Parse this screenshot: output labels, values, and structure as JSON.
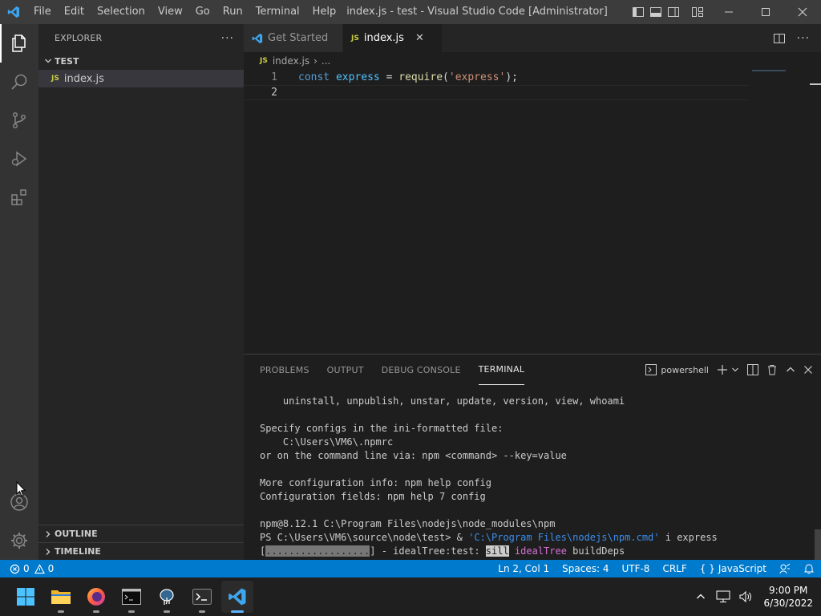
{
  "titlebar": {
    "menu": [
      "File",
      "Edit",
      "Selection",
      "View",
      "Go",
      "Run",
      "Terminal",
      "Help"
    ],
    "title": "index.js - test - Visual Studio Code [Administrator]"
  },
  "sidebar": {
    "header": "EXPLORER",
    "more": "···",
    "folder": "TEST",
    "file": "index.js",
    "file_badge": "JS",
    "outline": "OUTLINE",
    "timeline": "TIMELINE"
  },
  "tabs": [
    {
      "label": "Get Started",
      "icon": "vscode-icon"
    },
    {
      "label": "index.js",
      "badge": "JS",
      "close": "✕"
    }
  ],
  "breadcrumb": {
    "badge": "JS",
    "file": "index.js",
    "sep": "›",
    "more": "..."
  },
  "editor": {
    "lines": [
      {
        "number": "1",
        "tokens": [
          {
            "text": "const ",
            "cls": "kw"
          },
          {
            "text": "express",
            "cls": "var"
          },
          {
            "text": " = ",
            "cls": "punc"
          },
          {
            "text": "require",
            "cls": "fn"
          },
          {
            "text": "(",
            "cls": "punc"
          },
          {
            "text": "'express'",
            "cls": "str"
          },
          {
            "text": ");",
            "cls": "punc"
          }
        ]
      },
      {
        "number": "2",
        "tokens": []
      }
    ]
  },
  "panel": {
    "tabs": [
      "PROBLEMS",
      "OUTPUT",
      "DEBUG CONSOLE",
      "TERMINAL"
    ],
    "active_tab": "TERMINAL",
    "shell": "powershell",
    "terminal_lines": [
      [
        {
          "text": "    uninstall, unpublish, unstar, update, version, view, whoami"
        }
      ],
      [
        {
          "text": ""
        }
      ],
      [
        {
          "text": "Specify configs in the ini-formatted file:"
        }
      ],
      [
        {
          "text": "    C:\\Users\\VM6\\.npmrc"
        }
      ],
      [
        {
          "text": "or on the command line via: npm <command> --key=value"
        }
      ],
      [
        {
          "text": ""
        }
      ],
      [
        {
          "text": "More configuration info: npm help config"
        }
      ],
      [
        {
          "text": "Configuration fields: npm help 7 config"
        }
      ],
      [
        {
          "text": ""
        }
      ],
      [
        {
          "text": "npm@8.12.1 C:\\Program Files\\nodejs\\node_modules\\npm"
        }
      ],
      [
        {
          "text": "PS C:\\Users\\VM6\\source\\node\\test> & "
        },
        {
          "text": "'C:\\Program Files\\nodejs\\npm.cmd'",
          "cls": "tstr"
        },
        {
          "text": " i express"
        }
      ],
      [
        {
          "text": "["
        },
        {
          "text": "..................",
          "cls": "tprog"
        },
        {
          "text": "] - idealTree:test: "
        },
        {
          "text": "sill",
          "cls": "tsill"
        },
        {
          "text": " "
        },
        {
          "text": "idealTree",
          "cls": "tmag"
        },
        {
          "text": " buildDeps"
        }
      ]
    ]
  },
  "statusbar": {
    "errors": "0",
    "warnings": "0",
    "position": "Ln 2, Col 1",
    "spaces": "Spaces: 4",
    "encoding": "UTF-8",
    "eol": "CRLF",
    "language_braces": "{ }",
    "language": "JavaScript"
  },
  "taskbar": {
    "apps": [
      "windows-start",
      "file-explorer",
      "firefox",
      "command-prompt",
      "pgadmin",
      "terminal",
      "vscode"
    ],
    "time": "9:00 PM",
    "date": "6/30/2022"
  },
  "colors": {
    "accent": "#007acc",
    "activity_bar": "#333333",
    "sidebar": "#252526",
    "editor": "#1e1e1e",
    "titlebar": "#3c3c3c"
  }
}
